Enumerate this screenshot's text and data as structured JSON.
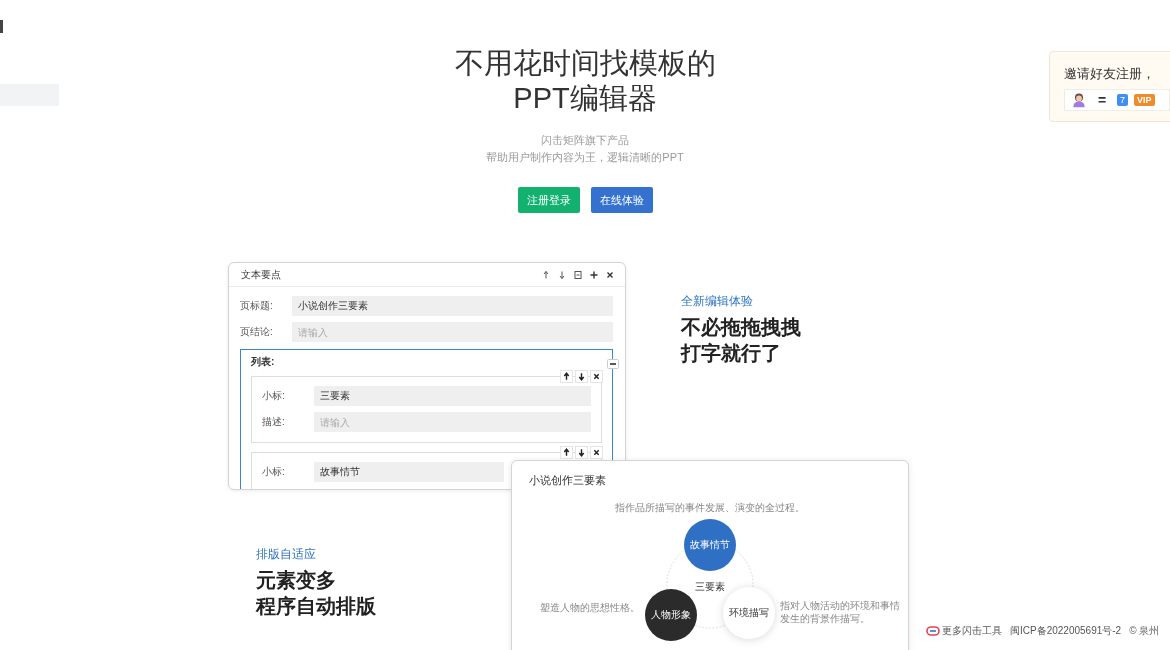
{
  "hero": {
    "title_lines": [
      "不用花时间找模板的",
      "PPT编辑器"
    ],
    "subtitle_lines": [
      "闪击矩阵旗下产品",
      "帮助用户制作内容为王，逻辑清晰的PPT"
    ],
    "buttons": [
      {
        "label": "注册登录",
        "kind": "primary"
      },
      {
        "label": "在线体验",
        "kind": "secondary"
      }
    ]
  },
  "invite": {
    "text": "邀请好友注册，",
    "equals": "=",
    "days": "7",
    "vip": "VIP"
  },
  "editor": {
    "title": "文本要点",
    "fields": [
      {
        "label": "页标题:",
        "value": "小说创作三要素"
      },
      {
        "label": "页结论:",
        "placeholder": "请输入"
      }
    ],
    "list": {
      "label": "列表:",
      "items": [
        {
          "fields": [
            {
              "label": "小标:",
              "value": "三要素"
            },
            {
              "label": "描述:",
              "placeholder": "请输入"
            }
          ]
        },
        {
          "fields": [
            {
              "label": "小标:",
              "value": "故事情节"
            }
          ]
        }
      ]
    }
  },
  "feature_edit": {
    "kicker": "全新编辑体验",
    "headline_lines": [
      "不必拖拖拽拽",
      "打字就行了"
    ]
  },
  "feature_layout": {
    "kicker": "排版自适应",
    "headline_lines": [
      "元素变多",
      "程序自动排版"
    ]
  },
  "preview": {
    "title": "小说创作三要素",
    "center": "三要素",
    "nodes": [
      {
        "label": "故事情节",
        "kind": "blue",
        "note": "指作品所描写的事件发展、演变的全过程。"
      },
      {
        "label": "人物形象",
        "kind": "dark",
        "note": "塑造人物的思想性格。"
      },
      {
        "label": "环境描写",
        "kind": "light",
        "note": "指对人物活动的环境和事情发生的背景作描写。"
      }
    ]
  },
  "footer": {
    "tools_link": "更多闪击工具",
    "icp": "闽ICP备2022005691号-2",
    "copyright": "© 泉州"
  }
}
